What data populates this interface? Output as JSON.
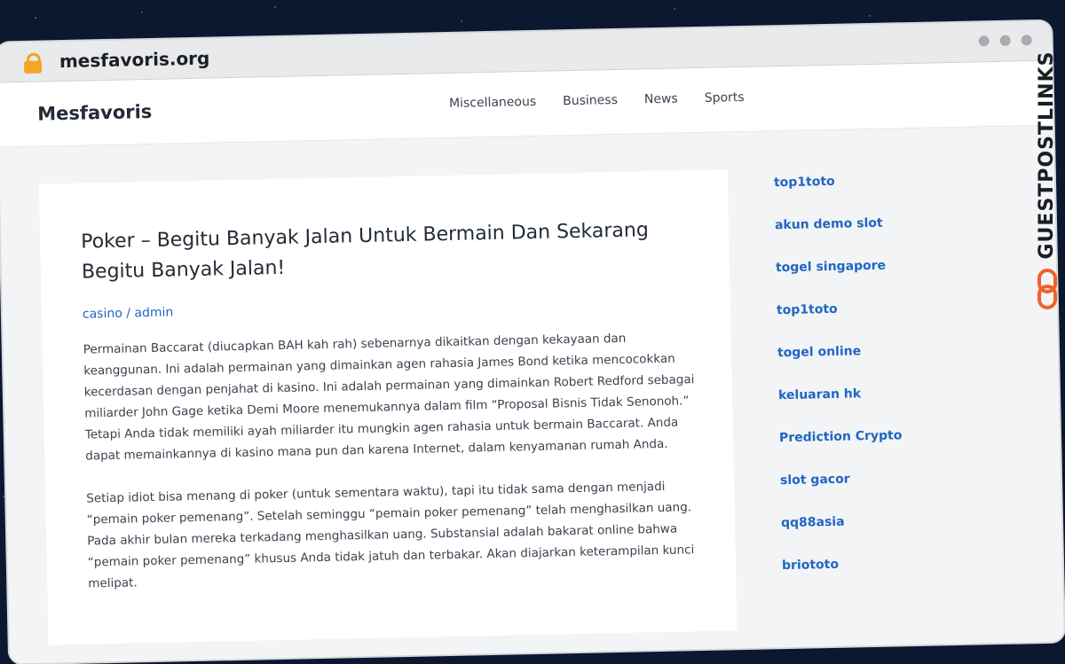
{
  "browser": {
    "url": "mesfavoris.org",
    "lock_icon": "lock-icon"
  },
  "site": {
    "title": "Mesfavoris",
    "nav": [
      "Miscellaneous",
      "Business",
      "News",
      "Sports"
    ]
  },
  "post": {
    "title": "Poker – Begitu Banyak Jalan Untuk Bermain Dan Sekarang Begitu Banyak Jalan!",
    "category": "casino",
    "separator": "/",
    "author": "admin",
    "paragraphs": [
      "Permainan Baccarat (diucapkan BAH kah rah) sebenarnya dikaitkan dengan kekayaan dan keanggunan. Ini adalah permainan yang dimainkan agen rahasia James Bond ketika mencocokkan kecerdasan dengan penjahat di kasino. Ini adalah permainan yang dimainkan Robert Redford sebagai miliarder John Gage ketika Demi Moore menemukannya dalam film “Proposal Bisnis Tidak Senonoh.” Tetapi Anda tidak memiliki ayah miliarder itu mungkin agen rahasia untuk bermain Baccarat. Anda dapat memainkannya di kasino mana pun dan karena Internet, dalam kenyamanan rumah Anda.",
      "Setiap idiot bisa menang di poker (untuk sementara waktu), tapi itu tidak sama dengan menjadi “pemain poker pemenang”. Setelah seminggu “pemain poker pemenang” telah menghasilkan uang. Pada akhir bulan mereka terkadang menghasilkan uang. Substansial adalah bakarat online bahwa “pemain poker pemenang” khusus Anda tidak jatuh dan terbakar. Akan diajarkan keterampilan kunci melipat."
    ]
  },
  "sidebar": {
    "links": [
      "top1toto",
      "akun demo slot",
      "togel singapore",
      "top1toto",
      "togel online",
      "keluaran hk",
      "Prediction Crypto",
      "slot gacor",
      "qq88asia",
      "briototo"
    ]
  },
  "badge": {
    "text": "GUESTPOSTLINKS",
    "icon": "chain-link-icon",
    "accent": "#f0622a"
  }
}
